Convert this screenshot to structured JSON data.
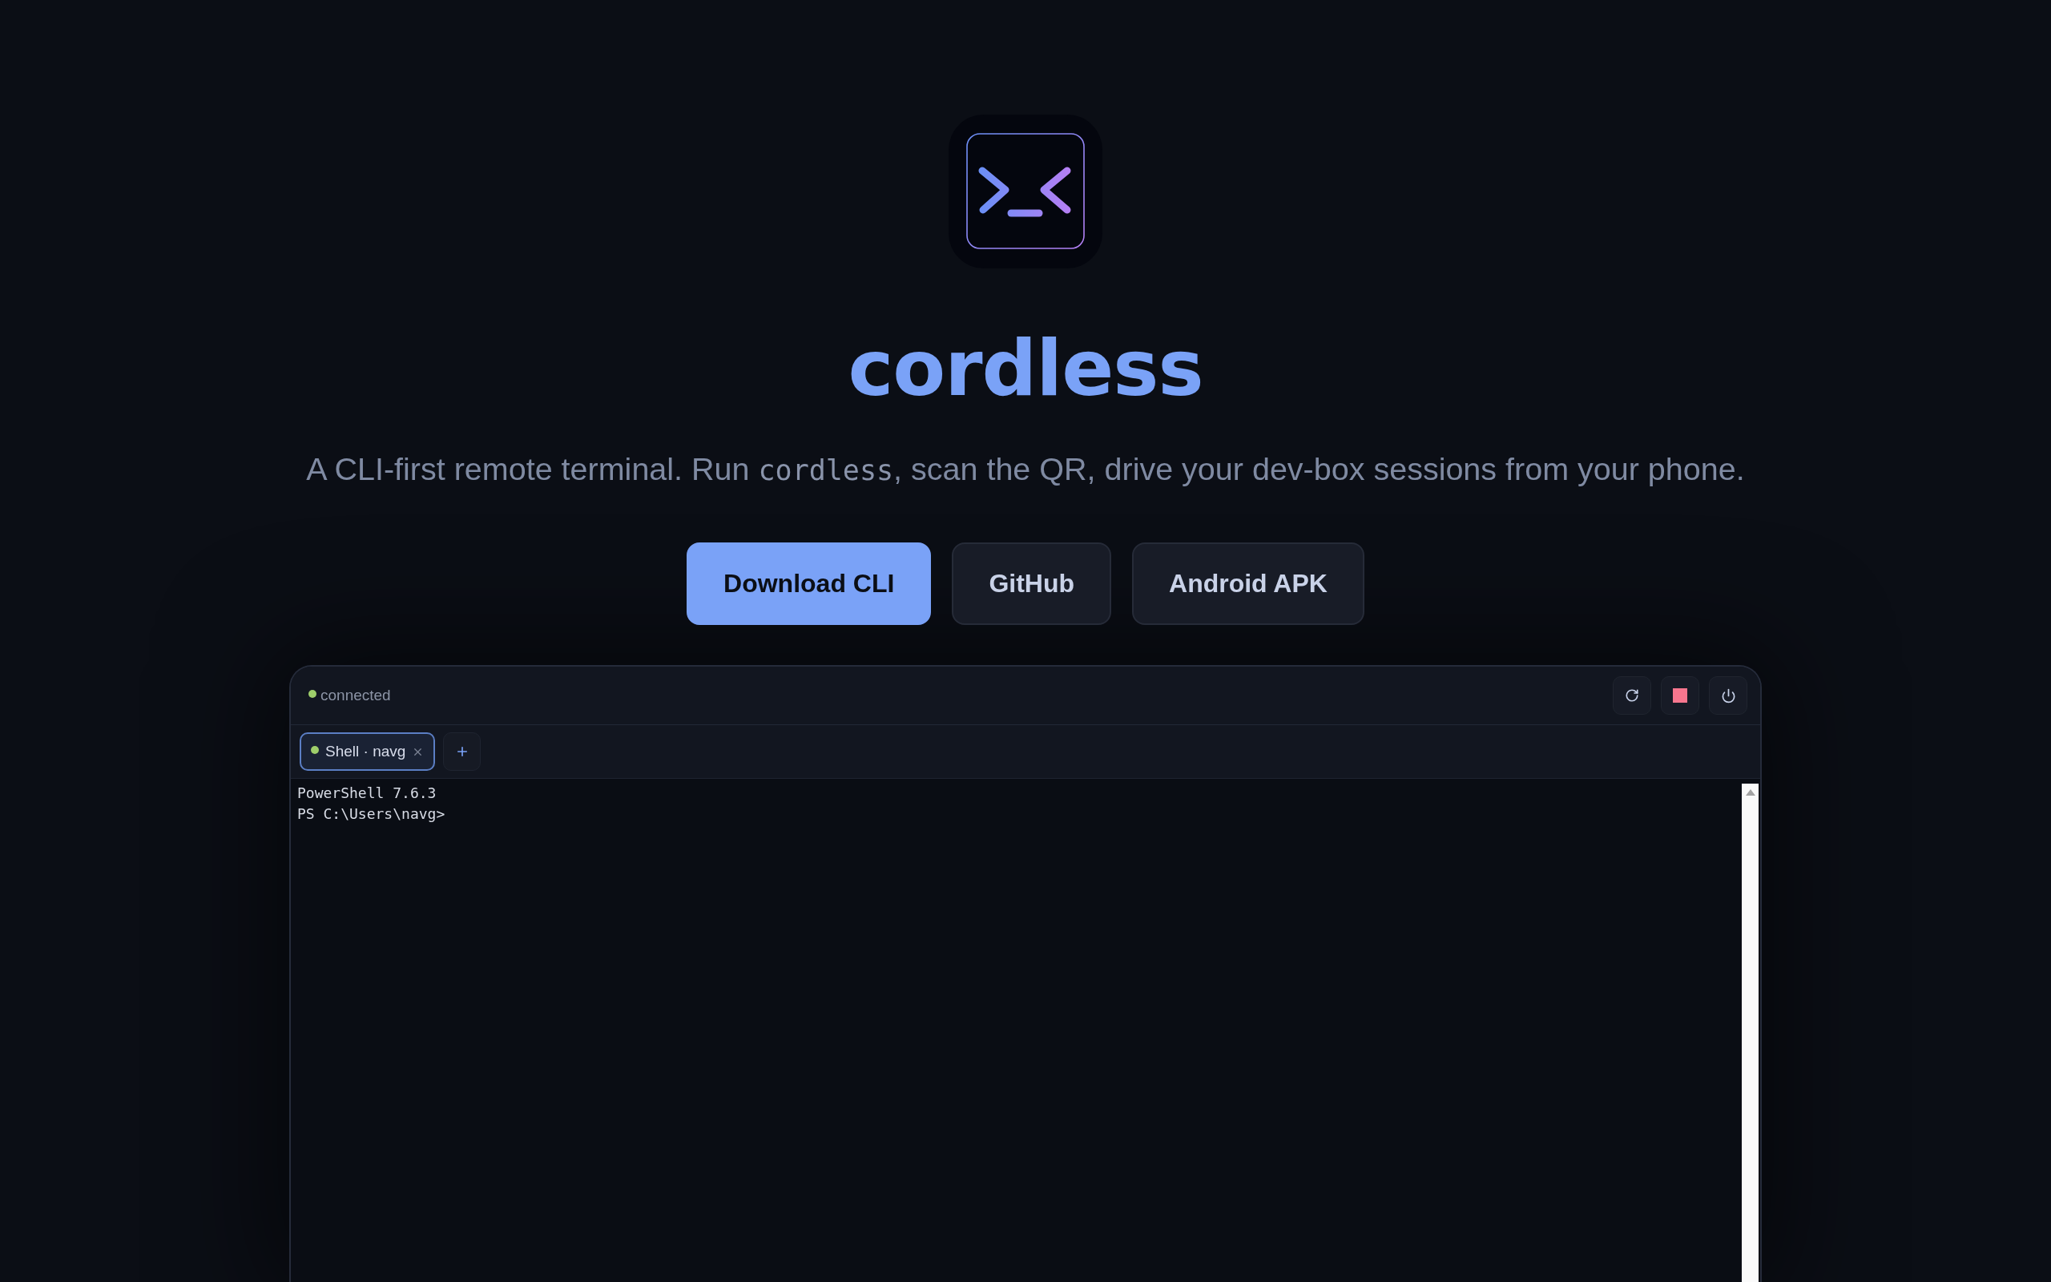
{
  "hero": {
    "title": "cordless",
    "tagline": {
      "before": "A CLI-first remote terminal. Run ",
      "code": "cordless",
      "after": ", scan the QR, drive your dev-box sessions from your phone."
    }
  },
  "actions": [
    {
      "label": "Download CLI",
      "kind": "primary"
    },
    {
      "label": "GitHub",
      "kind": "secondary"
    },
    {
      "label": "Android APK",
      "kind": "secondary"
    }
  ],
  "terminal": {
    "connection": {
      "label": "connected",
      "online": true
    },
    "tabs": [
      {
        "label": "Shell · navg",
        "selected": true,
        "online": true
      }
    ],
    "lines": [
      "PowerShell 7.6.3",
      "PS C:\\Users\\navg>"
    ]
  }
}
